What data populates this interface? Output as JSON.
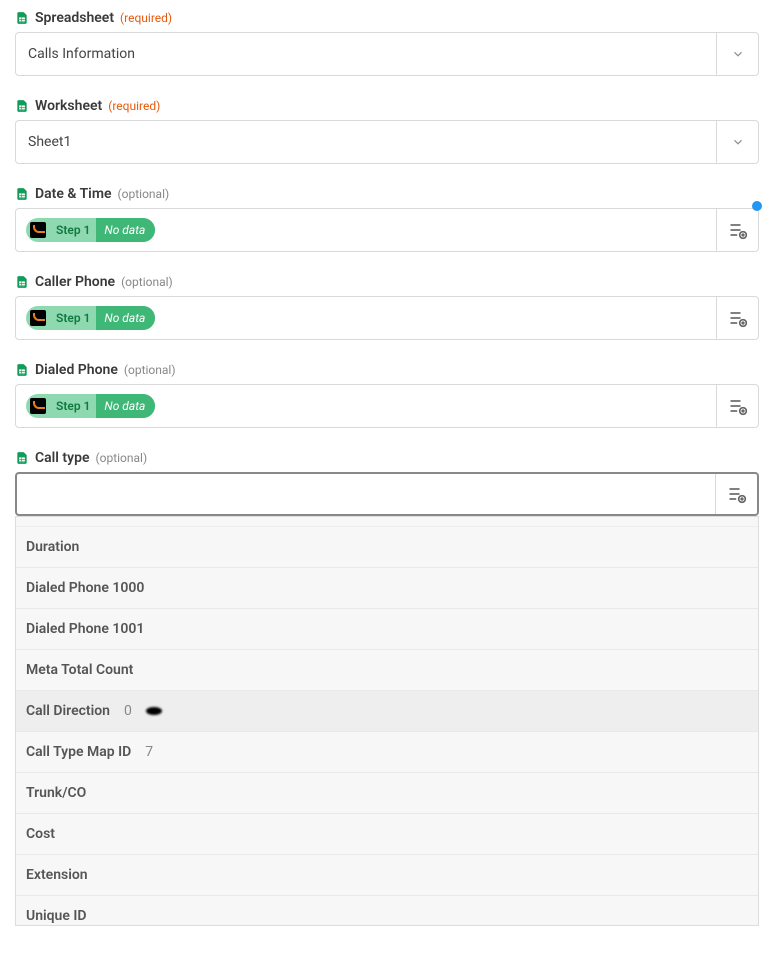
{
  "fields": {
    "spreadsheet": {
      "label": "Spreadsheet",
      "hint": "(required)",
      "hintClass": "required",
      "value": "Calls Information"
    },
    "worksheet": {
      "label": "Worksheet",
      "hint": "(required)",
      "hintClass": "required",
      "value": "Sheet1"
    },
    "datetime": {
      "label": "Date & Time",
      "hint": "(optional)",
      "hintClass": "optional",
      "chip_step": "Step 1",
      "chip_nodata": "No data",
      "has_dot": true
    },
    "caller_phone": {
      "label": "Caller Phone",
      "hint": "(optional)",
      "hintClass": "optional",
      "chip_step": "Step 1",
      "chip_nodata": "No data"
    },
    "dialed_phone": {
      "label": "Dialed Phone",
      "hint": "(optional)",
      "hintClass": "optional",
      "chip_step": "Step 1",
      "chip_nodata": "No data"
    },
    "call_type": {
      "label": "Call type",
      "hint": "(optional)",
      "hintClass": "optional"
    }
  },
  "dropdown": [
    {
      "label": "Duration",
      "value": "",
      "highlight": false
    },
    {
      "label": "Dialed Phone 1000",
      "value": "",
      "highlight": false
    },
    {
      "label": "Dialed Phone 1001",
      "value": "",
      "highlight": false
    },
    {
      "label": "Meta Total Count",
      "value": "",
      "highlight": false
    },
    {
      "label": "Call Direction",
      "value": "0",
      "highlight": true,
      "blob": true
    },
    {
      "label": "Call Type Map ID",
      "value": "7",
      "highlight": false
    },
    {
      "label": "Trunk/CO",
      "value": "",
      "highlight": false
    },
    {
      "label": "Cost",
      "value": "",
      "highlight": false
    },
    {
      "label": "Extension",
      "value": "",
      "highlight": false
    },
    {
      "label": "Unique ID",
      "value": "",
      "highlight": false
    }
  ]
}
